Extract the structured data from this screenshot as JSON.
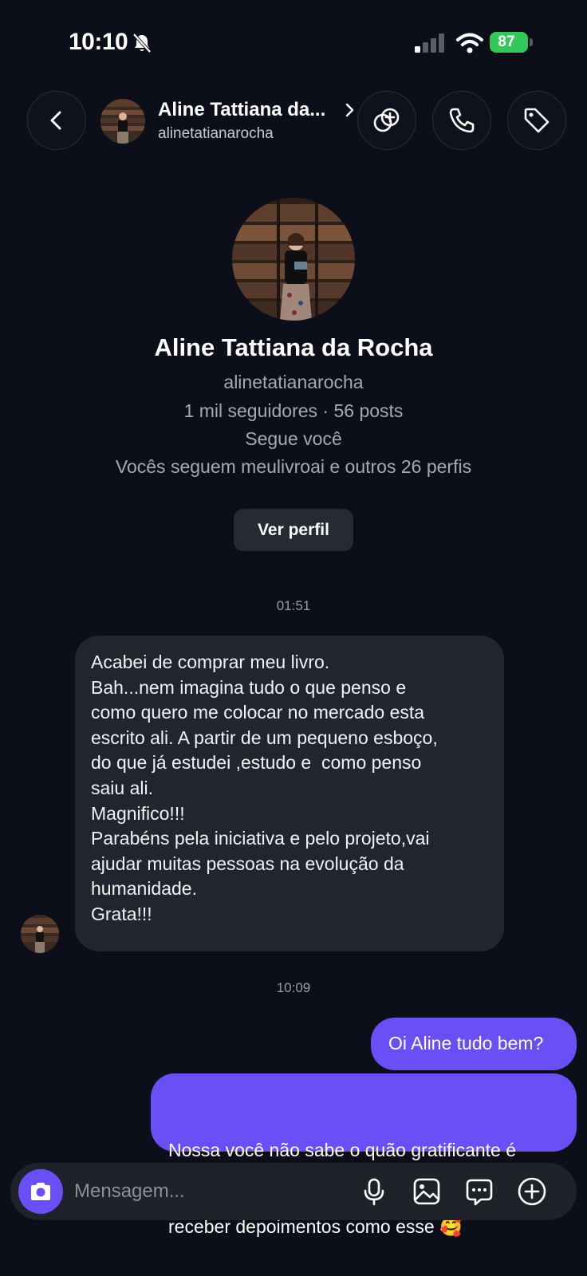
{
  "status_bar": {
    "time": "10:10",
    "battery": "87",
    "battery_color": "#34c759"
  },
  "header": {
    "name": "Aline Tattiana da...",
    "username": "alinetatianarocha",
    "icons": [
      "back-chevron-icon",
      "add-people-icon",
      "phone-icon",
      "tag-icon"
    ]
  },
  "profile": {
    "name": "Aline Tattiana da Rocha",
    "username": "alinetatianarocha",
    "stats": "1 mil seguidores · 56 posts",
    "follows_you": "Segue você",
    "mutual": "Vocês seguem meulivroai e outros 26 perfis",
    "view_profile_label": "Ver perfil"
  },
  "messages": {
    "time_1": "01:51",
    "incoming_lines": [
      "Acabei de comprar meu livro.",
      "Bah...nem imagina tudo o que penso e",
      "como quero me colocar no mercado esta",
      "escrito ali. A partir de um pequeno esboço,",
      "do que já estudei ,estudo e  como penso",
      "saiu ali.",
      "Magnifico!!!",
      "Parabéns pela iniciativa e pelo projeto,vai",
      "ajudar muitas pessoas na evolução da",
      "humanidade.",
      "Grata!!!"
    ],
    "time_2": "10:09",
    "outgoing_1": "Oi Aline tudo bem?",
    "outgoing_2_line_1": "Nossa você não sabe o quão gratificante é",
    "outgoing_2_line_2": "receber depoimentos como esse 🥰"
  },
  "composer": {
    "placeholder": "Mensagem...",
    "icons": [
      "camera-icon",
      "microphone-icon",
      "gallery-icon",
      "sticker-message-icon",
      "plus-circle-icon"
    ]
  },
  "colors": {
    "background": "#0c0f1a",
    "accent": "#6a4ff6",
    "incoming_bubble": "#22252e"
  }
}
